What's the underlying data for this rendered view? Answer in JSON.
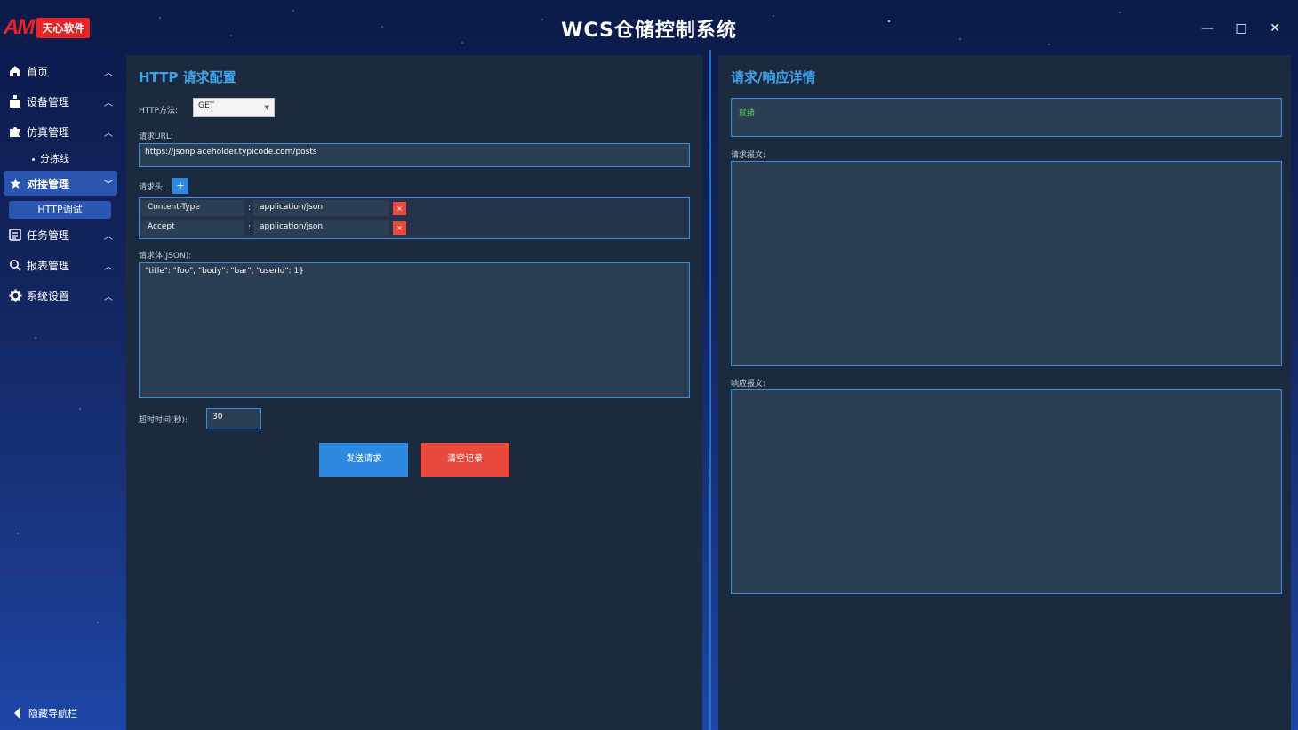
{
  "app": {
    "logo_mark": "AM",
    "logo_badge": "天心软件",
    "title": "WCS仓储控制系统",
    "win_min": "—",
    "win_max": "□",
    "win_close": "✕"
  },
  "sidebar": {
    "items": [
      {
        "label": "首页",
        "icon": "home-icon"
      },
      {
        "label": "设备管理",
        "icon": "device-icon"
      },
      {
        "label": "仿真管理",
        "icon": "puzzle-icon"
      },
      {
        "label": "对接管理",
        "icon": "star-icon"
      },
      {
        "label": "任务管理",
        "icon": "task-icon"
      },
      {
        "label": "报表管理",
        "icon": "search-icon"
      },
      {
        "label": "系统设置",
        "icon": "gear-icon"
      }
    ],
    "sub_sim": "分拣线",
    "sub_dock": "HTTP调试",
    "hide_nav": "隐藏导航栏"
  },
  "left": {
    "title": "HTTP 请求配置",
    "method_label": "HTTP方法:",
    "method_value": "GET",
    "url_label": "请求URL:",
    "url_value": "https://jsonplaceholder.typicode.com/posts",
    "headers_label": "请求头:",
    "add_label": "+",
    "headers": [
      {
        "key": "Content-Type",
        "value": "application/json"
      },
      {
        "key": "Accept",
        "value": "application/json"
      }
    ],
    "colon": ":",
    "delete_label": "×",
    "body_label": "请求体(JSON):",
    "body_value": "\"title\": \"foo\", \"body\": \"bar\", \"userId\": 1}",
    "timeout_label": "超时时间(秒):",
    "timeout_value": "30",
    "send_label": "发送请求",
    "clear_label": "清空记录"
  },
  "right": {
    "title": "请求/响应详情",
    "status": "就绪",
    "request_label": "请求报文:",
    "response_label": "响应报文:"
  },
  "colors": {
    "accent": "#3fa3ea",
    "send": "#2d8ae0",
    "clear": "#e84a3d",
    "status": "#55d35a"
  }
}
